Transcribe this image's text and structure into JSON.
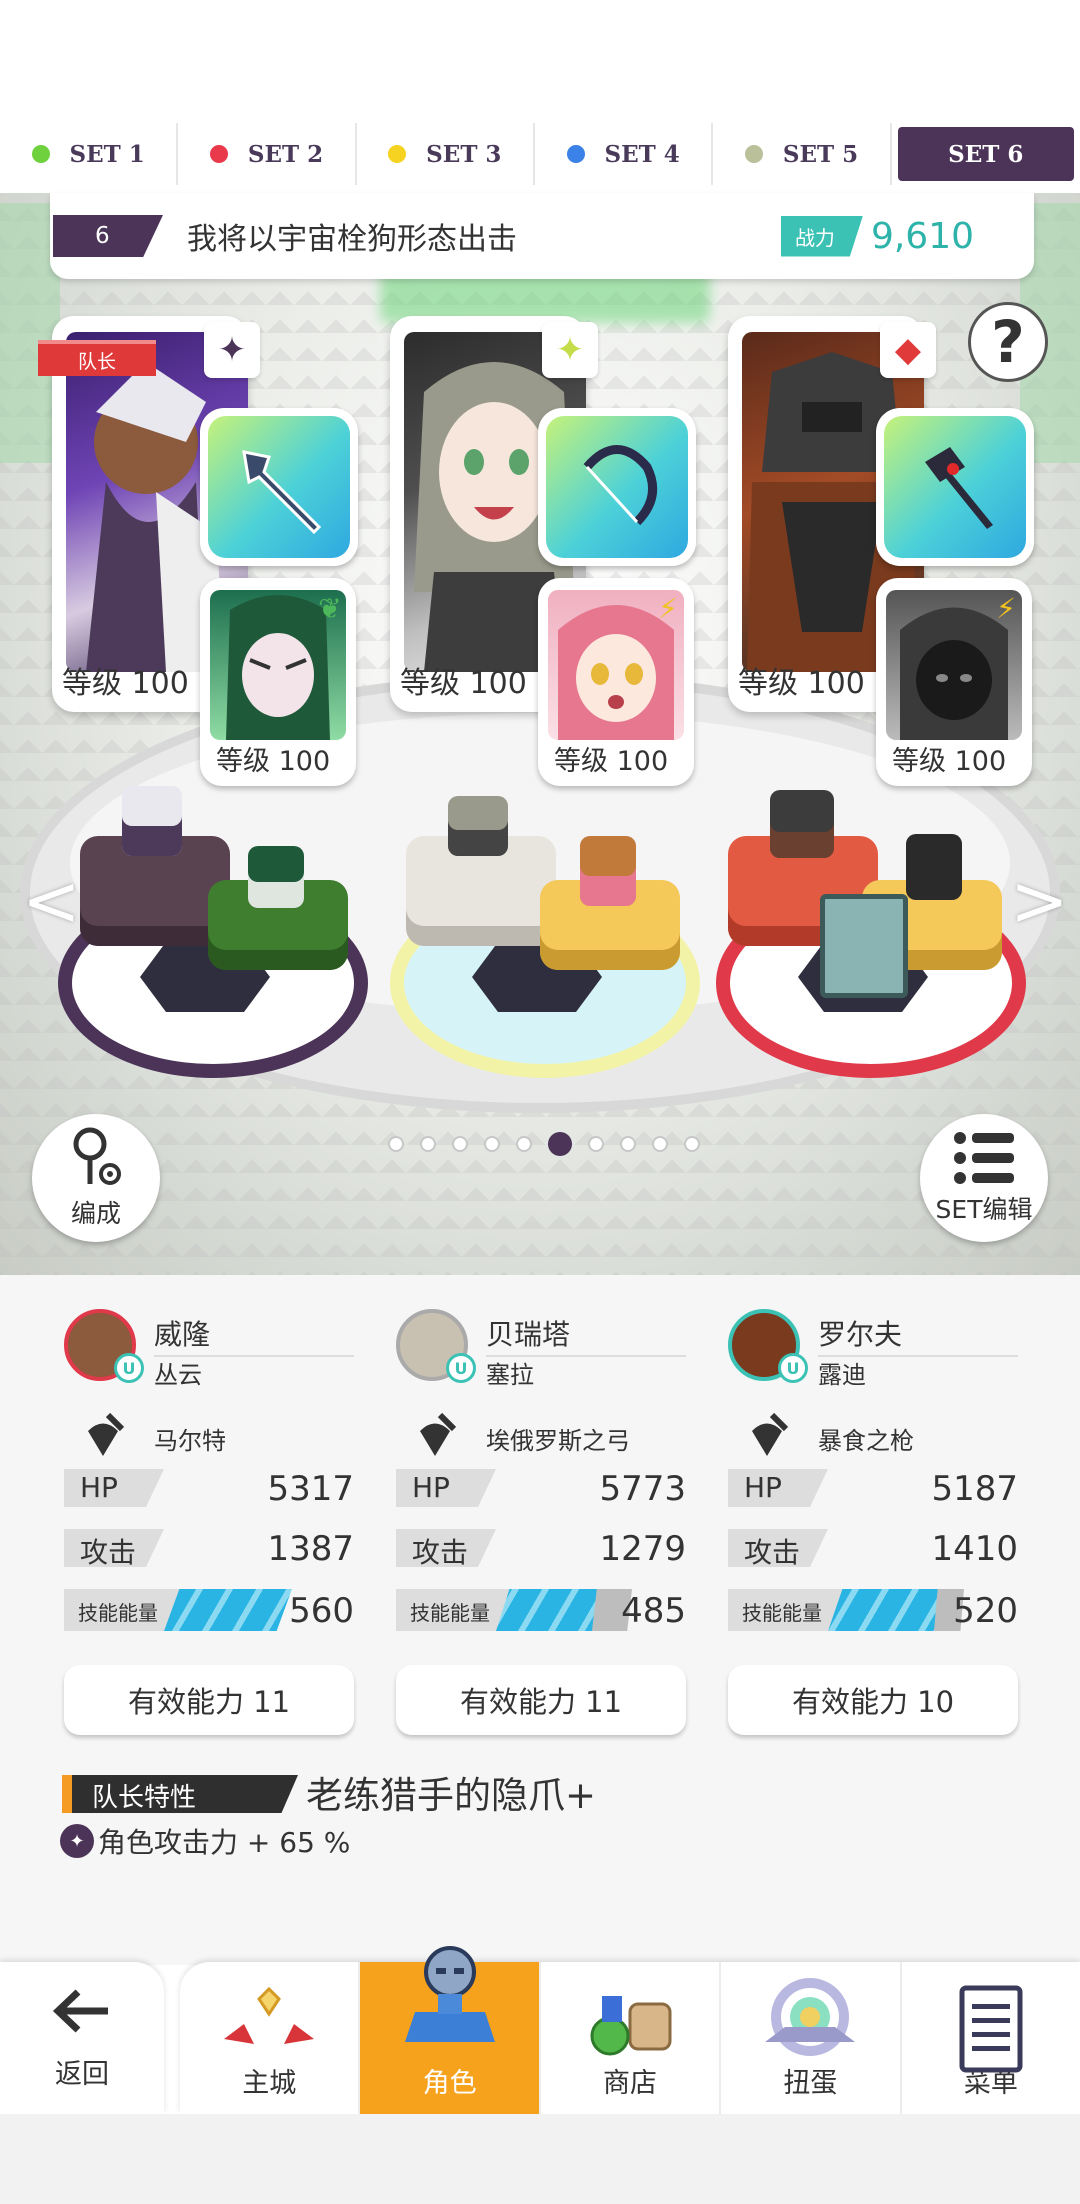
{
  "tabs": [
    {
      "label": "SET 1",
      "color": "#6fd13d"
    },
    {
      "label": "SET 2",
      "color": "#e83a4a"
    },
    {
      "label": "SET 3",
      "color": "#f5d320"
    },
    {
      "label": "SET 4",
      "color": "#3b82e8"
    },
    {
      "label": "SET 5",
      "color": "#b9c09a"
    },
    {
      "label": "SET 6",
      "color": null
    }
  ],
  "team": {
    "number": "6",
    "name": "我将以宇宙栓狗形态出击",
    "power_label": "战力",
    "power_value": "9,610"
  },
  "cards": {
    "captain_label": "队长",
    "main_levels": [
      "等级 100",
      "等级 100",
      "等级 100"
    ],
    "sub_levels": [
      "等级 100",
      "等级 100",
      "等级 100"
    ]
  },
  "help_icon": "?",
  "page_dots": {
    "count": 10,
    "active": 6
  },
  "buttons": {
    "formation": "编成",
    "set_edit": "SET编辑"
  },
  "characters": [
    {
      "name": "威隆",
      "sub": "丛云",
      "weapon": "马尔特",
      "hp_label": "HP",
      "hp": "5317",
      "atk_label": "攻击",
      "atk": "1387",
      "energy_label": "技能能量",
      "energy": "560",
      "effective": "有效能力 11"
    },
    {
      "name": "贝瑞塔",
      "sub": "塞拉",
      "weapon": "埃俄罗斯之弓",
      "hp_label": "HP",
      "hp": "5773",
      "atk_label": "攻击",
      "atk": "1279",
      "energy_label": "技能能量",
      "energy": "485",
      "effective": "有效能力 11"
    },
    {
      "name": "罗尔夫",
      "sub": "露迪",
      "weapon": "暴食之枪",
      "hp_label": "HP",
      "hp": "5187",
      "atk_label": "攻击",
      "atk": "1410",
      "energy_label": "技能能量",
      "energy": "520",
      "effective": "有效能力 10"
    }
  ],
  "leader": {
    "label": "队长特性",
    "name": "老练猎手的隐爪+",
    "effect": "角色攻击力 + 65 %"
  },
  "nav": {
    "back": "返回",
    "items": [
      "主城",
      "角色",
      "商店",
      "扭蛋",
      "菜单"
    ],
    "active": "角色"
  }
}
